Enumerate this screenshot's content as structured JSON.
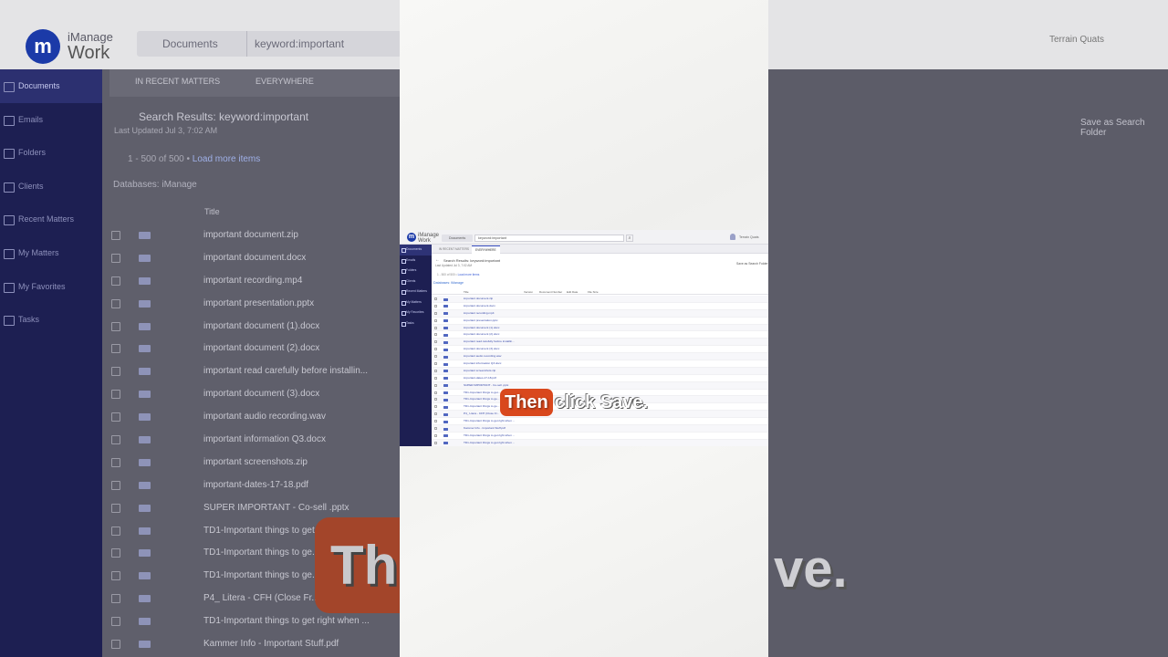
{
  "app": {
    "brand_top": "iManage",
    "brand_bottom": "Work",
    "logo_letter": "m"
  },
  "search": {
    "scope": "Documents",
    "query": "keyword:important"
  },
  "user": {
    "name": "Terrain Quats",
    "notifications": "10"
  },
  "sidebar": {
    "items": [
      {
        "label": "Documents"
      },
      {
        "label": "Emails"
      },
      {
        "label": "Folders"
      },
      {
        "label": "Clients"
      },
      {
        "label": "Recent Matters"
      },
      {
        "label": "My Matters"
      },
      {
        "label": "My Favorites"
      },
      {
        "label": "Tasks"
      }
    ]
  },
  "tabs": [
    {
      "label": "IN RECENT MATTERS"
    },
    {
      "label": "EVERYWHERE"
    }
  ],
  "results": {
    "title": "Search Results: keyword:important",
    "updated": "Last Updated Jul 3, 7:02 AM",
    "count": "1 - 500 of 500 •",
    "load_more": "Load more items",
    "database": "Databases: iManage",
    "save_search": "Save as Search Folder"
  },
  "columns": {
    "title": "Title",
    "version": "Version",
    "doc_number": "Document Number",
    "edit_date": "Edit Date",
    "file_size": "File Size"
  },
  "rows": [
    {
      "title": "important document.zip"
    },
    {
      "title": "important document.docx"
    },
    {
      "title": "important recording.mp4"
    },
    {
      "title": "important presentation.pptx"
    },
    {
      "title": "important document (1).docx"
    },
    {
      "title": "important document (2).docx"
    },
    {
      "title": "important read carefully before installin..."
    },
    {
      "title": "important document (3).docx"
    },
    {
      "title": "important audio recording.wav"
    },
    {
      "title": "important information Q3.docx"
    },
    {
      "title": "important screenshots.zip"
    },
    {
      "title": "important-dates-17-18.pdf"
    },
    {
      "title": "SUPER IMPORTANT - Co-sell .pptx"
    },
    {
      "title": "TD1-Important things to get..."
    },
    {
      "title": "TD1-Important things to ge..."
    },
    {
      "title": "TD1-Important things to ge..."
    },
    {
      "title": "P4_ Litera - CFH (Close Fr..."
    },
    {
      "title": "TD1-Important things to get right when ..."
    },
    {
      "title": "Kammer Info - Important Stuff.pdf"
    },
    {
      "title": "TD1-Important things to get right when ..."
    },
    {
      "title": "TD1-Important things to get right when ..."
    }
  ],
  "caption": {
    "highlight": "Then",
    "rest": "click Save."
  },
  "background_caption": {
    "left": "Th",
    "right": "ve."
  },
  "colors": {
    "sidebar": "#1d1f52",
    "accent": "#3046b8",
    "caption_tag": "#d9481d"
  }
}
